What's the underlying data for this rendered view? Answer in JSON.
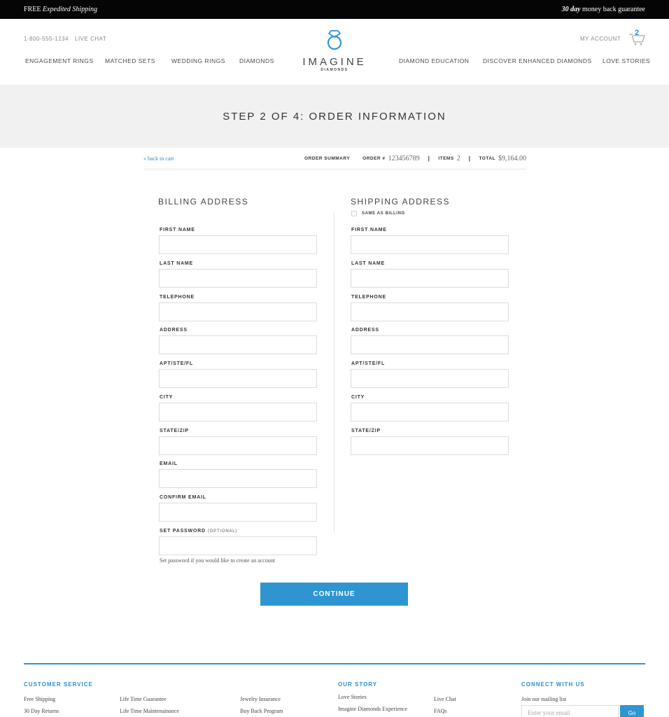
{
  "topbar": {
    "free": "FREE",
    "shipping": "Expedited Shipping",
    "guarantee_bold": "30 day",
    "guarantee_rest": "money back guarantee"
  },
  "header": {
    "phone": "1-800-555-1234",
    "live_chat": "LIVE CHAT",
    "my_account": "MY ACCOUNT",
    "cart_count": "2",
    "logo_word": "IMAGINE",
    "logo_sub": "DIAMONDS",
    "accent_color": "#2e95d1",
    "nav_left": [
      "ENGAGEMENT RINGS",
      "MATCHED SETS",
      "WEDDING RINGS",
      "DIAMONDS"
    ],
    "nav_right": [
      "DIAMOND EDUCATION",
      "DISCOVER ENHANCED DIAMONDS",
      "LOVE STORIES"
    ]
  },
  "banner": {
    "title": "STEP 2 OF 4: ORDER INFORMATION"
  },
  "summary": {
    "back_link": "« back to cart",
    "order_summary": "ORDER SUMMARY",
    "order_label": "ORDER #",
    "order_number": "123456789",
    "items_label": "ITEMS",
    "items_value": "2",
    "total_label": "TOTAL",
    "total_value": "$9,164.00",
    "separator": "|"
  },
  "billing": {
    "title": "BILLING ADDRESS",
    "fields": {
      "first_name": "FIRST NAME",
      "last_name": "LAST NAME",
      "telephone": "TELEPHONE",
      "address": "ADDRESS",
      "apt": "APT/STE/FL",
      "city": "CITY",
      "state_zip": "STATE/ZIP",
      "email": "EMAIL",
      "confirm_email": "CONFIRM EMAIL",
      "password": "SET PASSWORD",
      "password_optional": "(OPTIONAL)"
    },
    "password_hint": "Set password if you would like to create an account"
  },
  "shipping": {
    "title": "SHIPPING ADDRESS",
    "same_as_billing": "SAME AS BILLING",
    "fields": {
      "first_name": "FIRST NAME",
      "last_name": "LAST NAME",
      "telephone": "TELEPHONE",
      "address": "ADDRESS",
      "apt": "APT/STE/FL",
      "city": "CITY",
      "state_zip": "STATE/ZIP"
    }
  },
  "continue_label": "CONTINUE",
  "footer": {
    "customer_service": "CUSTOMER SERVICE",
    "our_story": "OUR STORY",
    "connect": "CONNECT WITH US",
    "cs_links": [
      "Free Shipping",
      "30 Day Returns",
      "Life Time Guarantee",
      "Life Time Maintenainance",
      "Jewelry Insurance",
      "Buy Back Program"
    ],
    "story_links": [
      "Love Stories",
      "Imagine Diamonds Experience",
      "Live Chat",
      "FAQs"
    ],
    "mailing_label": "Join our mailing list",
    "email_placeholder": "Enter your email",
    "go_label": "Go"
  }
}
